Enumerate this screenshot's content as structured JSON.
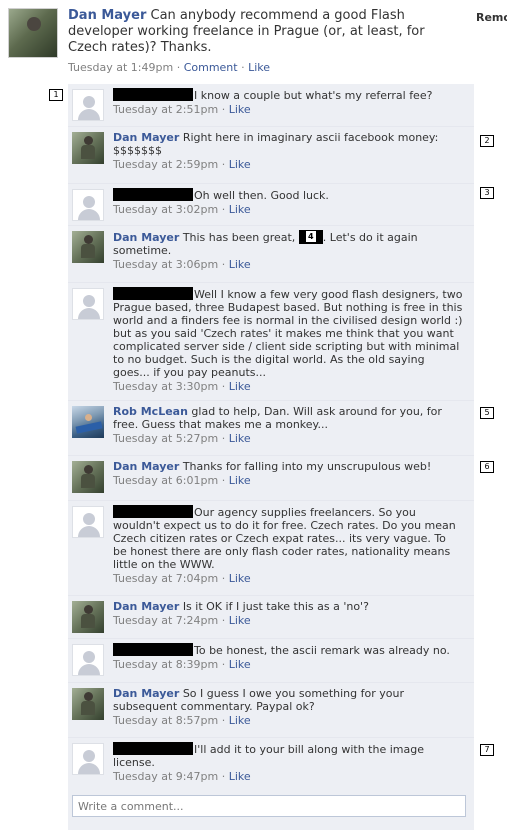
{
  "post": {
    "author": "Dan Mayer",
    "text": "Can anybody recommend a good Flash developer working freelance in Prague (or, at least, for Czech rates)? Thanks.",
    "time": "Tuesday at 1:49pm",
    "sep1": "·",
    "comment_label": "Comment",
    "sep2": "·",
    "like_label": "Like",
    "remove_label": "Remo"
  },
  "comments": [
    {
      "author": "",
      "text": "I know a couple but what's my referral fee?",
      "time": "Tuesday at 2:51pm",
      "sep": "·",
      "like": "Like"
    },
    {
      "author": "Dan Mayer",
      "text": "Right here in imaginary ascii facebook money: $$$$$$$",
      "time": "Tuesday at 2:59pm",
      "sep": "·",
      "like": "Like"
    },
    {
      "author": "",
      "text": "Oh well then. Good luck.",
      "time": "Tuesday at 3:02pm",
      "sep": "·",
      "like": "Like"
    },
    {
      "author": "Dan Mayer",
      "text_before": "This has been great,",
      "text_after": ". Let's do it again sometime.",
      "time": "Tuesday at 3:06pm",
      "sep": "·",
      "like": "Like"
    },
    {
      "author": "",
      "text": "Well I know a few very good flash designers, two Prague based, three Budapest based. But nothing is free in this world and a finders fee is normal in the civilised design world :) but as you said 'Czech rates' it makes me think that you want complicated server side / client side scripting but with minimal to no budget. Such is the digital world. As the old saying goes... if you pay peanuts...",
      "time": "Tuesday at 3:30pm",
      "sep": "·",
      "like": "Like"
    },
    {
      "author": "Rob McLean",
      "text": "glad to help, Dan. Will ask around for you, for free. Guess that makes me a monkey...",
      "time": "Tuesday at 5:27pm",
      "sep": "·",
      "like": "Like"
    },
    {
      "author": "Dan Mayer",
      "text": "Thanks for falling into my unscrupulous web!",
      "time": "Tuesday at 6:01pm",
      "sep": "·",
      "like": "Like"
    },
    {
      "author": "",
      "text": "Our agency supplies freelancers. So you wouldn't expect us to do it for free. Czech rates. Do you mean Czech citizen rates or Czech expat rates... its very vague. To be honest there are only flash coder rates, nationality means little on the WWW.",
      "time": "Tuesday at 7:04pm",
      "sep": "·",
      "like": "Like"
    },
    {
      "author": "Dan Mayer",
      "text": "Is it OK if I just take this as a 'no'?",
      "time": "Tuesday at 7:24pm",
      "sep": "·",
      "like": "Like"
    },
    {
      "author": "",
      "text": "To be honest, the ascii remark was already no.",
      "time": "Tuesday at 8:39pm",
      "sep": "·",
      "like": "Like"
    },
    {
      "author": "Dan Mayer",
      "text": "So I guess I owe you something for your subsequent commentary. Paypal ok?",
      "time": "Tuesday at 8:57pm",
      "sep": "·",
      "like": "Like"
    },
    {
      "author": "",
      "text": "I'll add it to your bill along with the image license.",
      "time": "Tuesday at 9:47pm",
      "sep": "·",
      "like": "Like"
    }
  ],
  "markers": [
    "1",
    "2",
    "3",
    "4",
    "5",
    "6",
    "7"
  ],
  "write_comment_placeholder": "Write a comment...",
  "icons": {
    "generic_avatar": "default-user-avatar-icon",
    "redaction": "redaction-block"
  },
  "colors": {
    "link": "#3b5998",
    "thread_bg": "#edeff4",
    "meta_gray": "#808080"
  }
}
